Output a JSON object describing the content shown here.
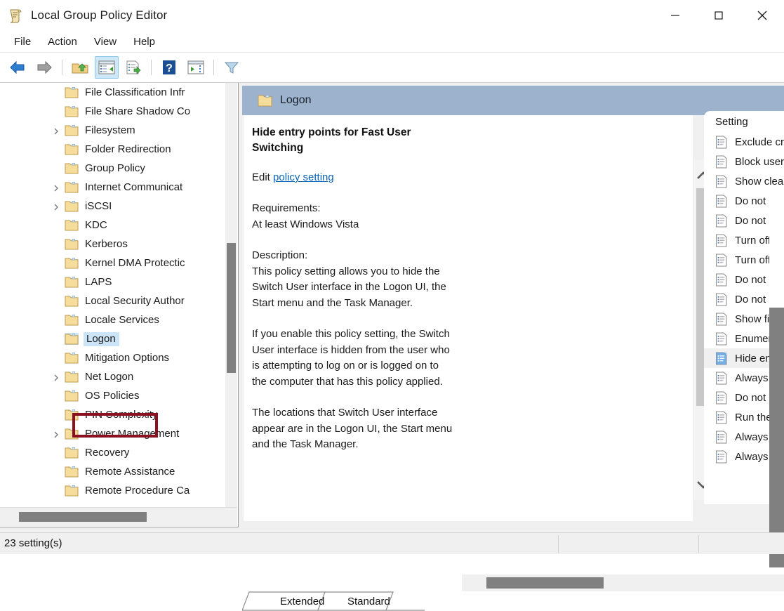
{
  "window": {
    "title": "Local Group Policy Editor",
    "icon": "policy-scroll-icon",
    "controls": {
      "minimize": "minimize-icon",
      "maximize": "maximize-icon",
      "close": "close-icon"
    }
  },
  "menu": {
    "items": [
      {
        "label": "File"
      },
      {
        "label": "Action"
      },
      {
        "label": "View"
      },
      {
        "label": "Help"
      }
    ]
  },
  "toolbar": {
    "buttons": [
      {
        "name": "back-icon",
        "tip": "Back"
      },
      {
        "name": "forward-icon",
        "tip": "Forward"
      },
      {
        "name": "up-folder-icon",
        "tip": "Up One Level"
      },
      {
        "name": "show-hide-console-tree-icon",
        "tip": "Show/Hide Console Tree",
        "active": true
      },
      {
        "name": "export-list-icon",
        "tip": "Export List"
      },
      {
        "name": "help-icon",
        "tip": "Help"
      },
      {
        "name": "show-hide-action-pane-icon",
        "tip": "Show/Hide Action Pane"
      },
      {
        "name": "filter-icon",
        "tip": "Filter"
      }
    ]
  },
  "tree": {
    "items": [
      {
        "label": "File Classification Infr",
        "expandable": false
      },
      {
        "label": "File Share Shadow Co",
        "expandable": false
      },
      {
        "label": "Filesystem",
        "expandable": true
      },
      {
        "label": "Folder Redirection",
        "expandable": false
      },
      {
        "label": "Group Policy",
        "expandable": false
      },
      {
        "label": "Internet Communicat",
        "expandable": true
      },
      {
        "label": "iSCSI",
        "expandable": true
      },
      {
        "label": "KDC",
        "expandable": false
      },
      {
        "label": "Kerberos",
        "expandable": false
      },
      {
        "label": "Kernel DMA Protectic",
        "expandable": false
      },
      {
        "label": "LAPS",
        "expandable": false
      },
      {
        "label": "Local Security Author",
        "expandable": false
      },
      {
        "label": "Locale Services",
        "expandable": false
      },
      {
        "label": "Logon",
        "expandable": false,
        "selected": true
      },
      {
        "label": "Mitigation Options",
        "expandable": false
      },
      {
        "label": "Net Logon",
        "expandable": true
      },
      {
        "label": "OS Policies",
        "expandable": false
      },
      {
        "label": "PIN Complexity",
        "expandable": false
      },
      {
        "label": "Power Management",
        "expandable": true
      },
      {
        "label": "Recovery",
        "expandable": false
      },
      {
        "label": "Remote Assistance",
        "expandable": false
      },
      {
        "label": "Remote Procedure Ca",
        "expandable": false
      }
    ],
    "highlight_color": "#8a1220"
  },
  "result_header": {
    "title": "Logon",
    "icon": "folder-icon"
  },
  "description": {
    "policy_title": "Hide entry points for Fast User Switching",
    "edit_prefix": "Edit ",
    "edit_link": "policy setting",
    "requirements_label": "Requirements:",
    "requirements_value": "At least Windows Vista",
    "description_label": "Description:",
    "paragraph1": "This policy setting allows you to hide the Switch User interface in the Logon UI, the Start menu and the Task Manager.",
    "paragraph2": "If you enable this policy setting, the Switch User interface is hidden from the user who is attempting to log on or is logged on to the computer that has this policy applied.",
    "paragraph3": "The locations that Switch User interface appear are in the Logon UI, the Start menu and the Task Manager."
  },
  "settings_list": {
    "column_header": "Setting",
    "rows": [
      {
        "label": "Exclude credential providers"
      },
      {
        "label": "Block user from showing account details on sign-in"
      },
      {
        "label": "Show clear logon background"
      },
      {
        "label": "Do not process the legacy run list"
      },
      {
        "label": "Do not process the run once list"
      },
      {
        "label": "Turn off app notifications on the lock screen"
      },
      {
        "label": "Turn off Windows Startup sound"
      },
      {
        "label": "Do not display network selection UI"
      },
      {
        "label": "Do not enumerate connected users on domain-joined"
      },
      {
        "label": "Show first sign-in animation"
      },
      {
        "label": "Enumerate local users on domain-joined computers"
      },
      {
        "label": "Hide entry points for Fast User Switching",
        "selected": true
      },
      {
        "label": "Always use classic logon"
      },
      {
        "label": "Do not display the Getting Started welcome screen"
      },
      {
        "label": "Run these programs at user logon"
      },
      {
        "label": "Always wait for the network at computer startup an"
      },
      {
        "label": "Always use custom logon background"
      }
    ]
  },
  "tabs": [
    {
      "label": "Extended",
      "active": true
    },
    {
      "label": "Standard",
      "active": false
    }
  ],
  "statusbar": {
    "text": "23 setting(s)"
  }
}
